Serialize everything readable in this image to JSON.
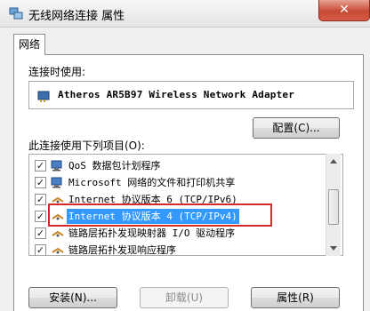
{
  "window": {
    "title": "无线网络连接 属性",
    "close_glyph": "✕"
  },
  "tab": {
    "label": "网络"
  },
  "connect_using": {
    "label": "连接时使用:",
    "adapter": "Atheros AR5B97 Wireless Network Adapter"
  },
  "configure_button": "配置(C)...",
  "items_label": "此连接使用下列项目(O):",
  "items": [
    {
      "label": "QoS 数据包计划程序",
      "checked": true,
      "icon": "qos-icon"
    },
    {
      "label": "Microsoft 网络的文件和打印机共享",
      "checked": true,
      "icon": "network-share-icon"
    },
    {
      "label": "Internet 协议版本 6 (TCP/IPv6)",
      "checked": true,
      "icon": "protocol-icon"
    },
    {
      "label": "Internet 协议版本 4 (TCP/IPv4)",
      "checked": true,
      "icon": "protocol-icon",
      "selected": true
    },
    {
      "label": "链路层拓扑发现映射器 I/O 驱动程序",
      "checked": true,
      "icon": "protocol-icon"
    },
    {
      "label": "链路层拓扑发现响应程序",
      "checked": true,
      "icon": "protocol-icon"
    }
  ],
  "buttons": {
    "install": "安装(N)...",
    "uninstall": "卸载(U)",
    "properties": "属性(R)"
  },
  "colors": {
    "selection": "#3399ff",
    "highlight_box": "#d62a2a"
  }
}
